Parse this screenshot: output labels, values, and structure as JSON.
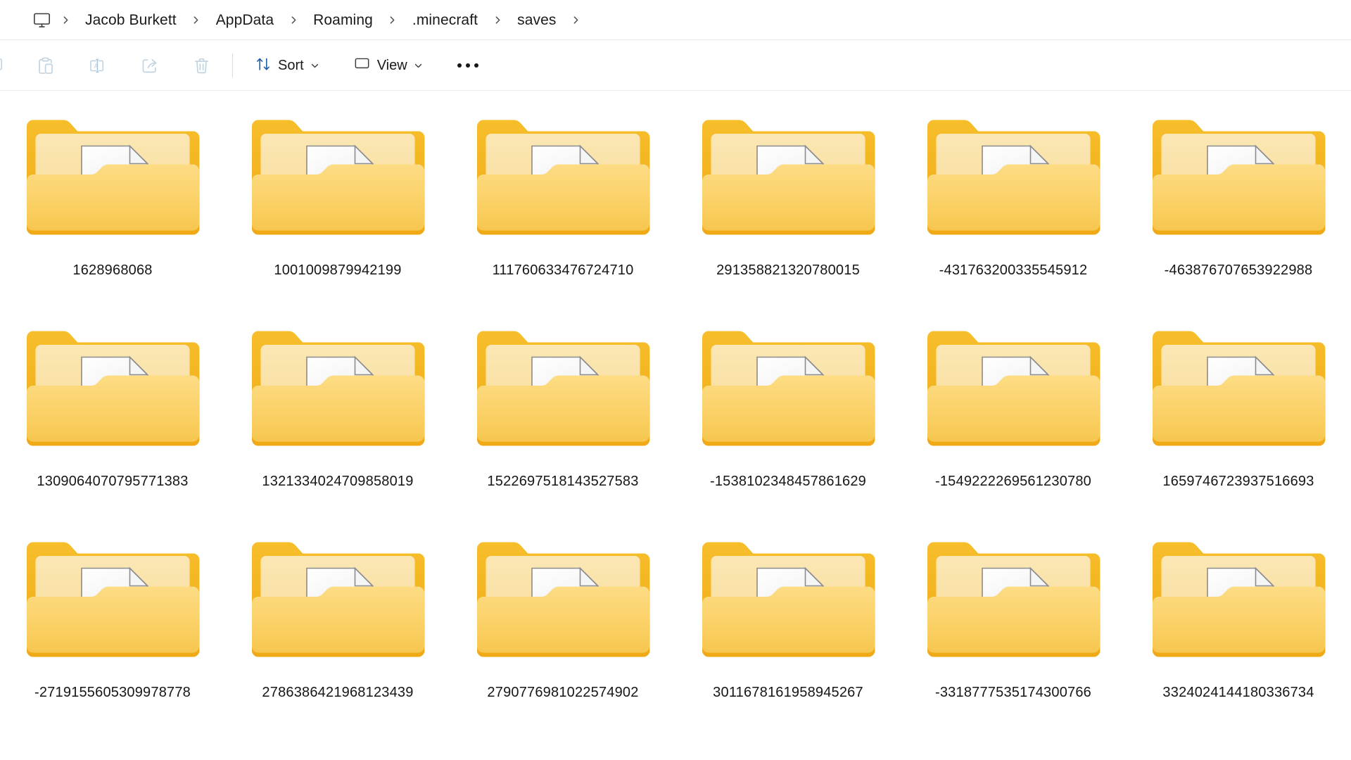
{
  "window": {
    "app": "File Explorer",
    "view_mode": "large-icons"
  },
  "addressbar": {
    "root_icon": "this-pc-monitor-icon",
    "separator_glyph": "chevron-right-icon",
    "crumbs": [
      {
        "label": "Jacob Burkett"
      },
      {
        "label": "AppData"
      },
      {
        "label": "Roaming"
      },
      {
        "label": ".minecraft"
      },
      {
        "label": "saves"
      }
    ]
  },
  "toolbar": {
    "icon_buttons": [
      {
        "name": "copy-icon",
        "label": "Copy",
        "enabled": false,
        "clipped": true
      },
      {
        "name": "paste-icon",
        "label": "Paste",
        "enabled": false
      },
      {
        "name": "rename-icon",
        "label": "Rename",
        "enabled": false
      },
      {
        "name": "share-icon",
        "label": "Share",
        "enabled": false
      },
      {
        "name": "delete-icon",
        "label": "Delete",
        "enabled": false
      }
    ],
    "sort_label": "Sort",
    "view_label": "View",
    "overflow_label": "See more",
    "caret_glyph": "chevron-down-icon"
  },
  "colors": {
    "folder_back_tab": "#F5B624",
    "folder_mid_panel": "#FAE1A4",
    "folder_front_flap": "#FBD167",
    "folder_edge": "#E8A81C",
    "sheet_fill": "#FDFDFD",
    "sheet_stroke": "#8C8C8C",
    "text": "#161616",
    "toolbar_icon": "#C2D3E0",
    "sort_icon_accent": "#1F5FA8",
    "background": "#FFFFFF",
    "divider": "#E8E8E8"
  },
  "items": [
    {
      "name": "1628968068",
      "type": "folder"
    },
    {
      "name": "1001009879942199",
      "type": "folder"
    },
    {
      "name": "111760633476724710",
      "type": "folder"
    },
    {
      "name": "291358821320780015",
      "type": "folder"
    },
    {
      "name": "-431763200335545912",
      "type": "folder"
    },
    {
      "name": "-463876707653922988",
      "type": "folder"
    },
    {
      "name": "1309064070795771383",
      "type": "folder"
    },
    {
      "name": "1321334024709858019",
      "type": "folder"
    },
    {
      "name": "1522697518143527583",
      "type": "folder"
    },
    {
      "name": "-1538102348457861629",
      "type": "folder"
    },
    {
      "name": "-1549222269561230780",
      "type": "folder"
    },
    {
      "name": "1659746723937516693",
      "type": "folder"
    },
    {
      "name": "-2719155605309978778",
      "type": "folder"
    },
    {
      "name": "2786386421968123439",
      "type": "folder"
    },
    {
      "name": "2790776981022574902",
      "type": "folder"
    },
    {
      "name": "3011678161958945267",
      "type": "folder"
    },
    {
      "name": "-3318777535174300766",
      "type": "folder"
    },
    {
      "name": "3324024144180336734",
      "type": "folder"
    }
  ]
}
